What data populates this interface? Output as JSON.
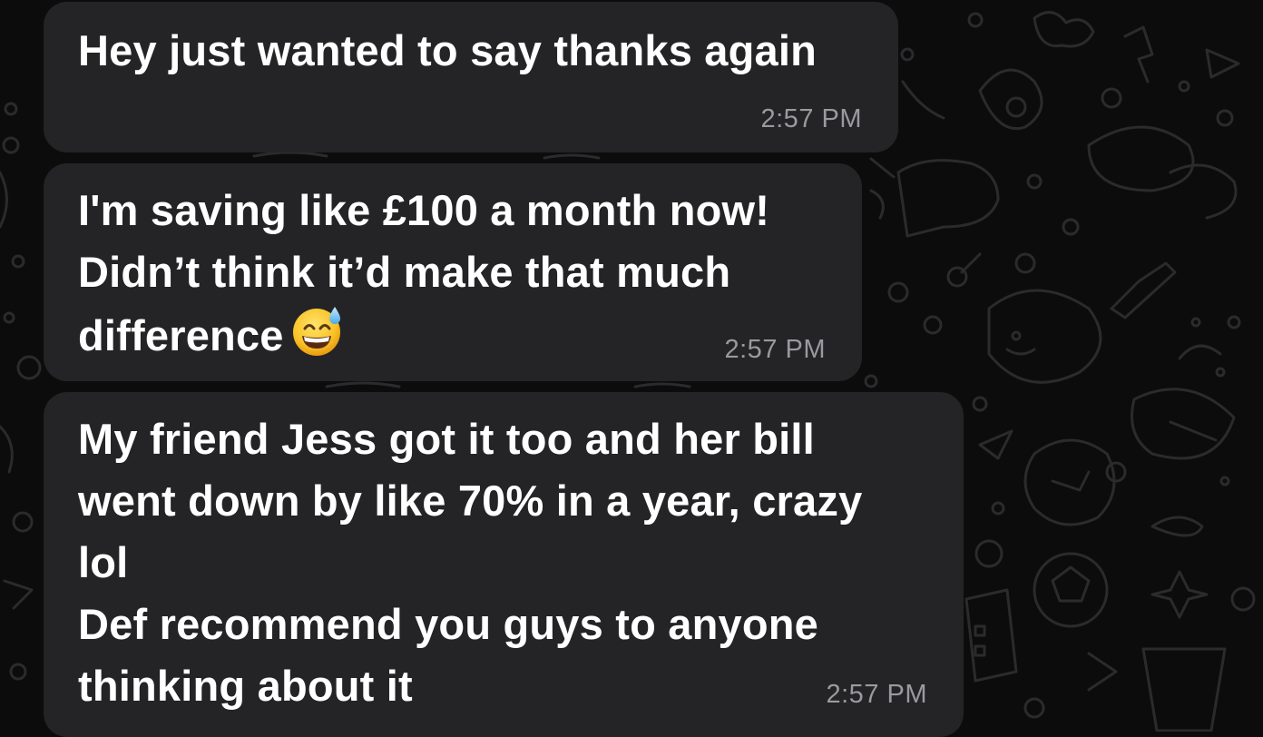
{
  "messages": [
    {
      "text": "Hey just wanted to say thanks again",
      "time": "2:57 PM"
    },
    {
      "text": "I'm saving like £100 a month now!\nDidn’t think it’d make that much\ndifference",
      "emoji": "grinning-face-with-sweat-icon",
      "time": "2:57 PM"
    },
    {
      "text": "My friend Jess got it too and her bill\nwent down by like 70% in a year, crazy\nlol\nDef recommend you guys to anyone\nthinking about it",
      "time": "2:57 PM"
    }
  ],
  "colors": {
    "background": "#0c0c0c",
    "bubble": "#242426",
    "text": "#ffffff",
    "timestamp": "#9a9a9e",
    "doodle": "#2c2c2e"
  }
}
